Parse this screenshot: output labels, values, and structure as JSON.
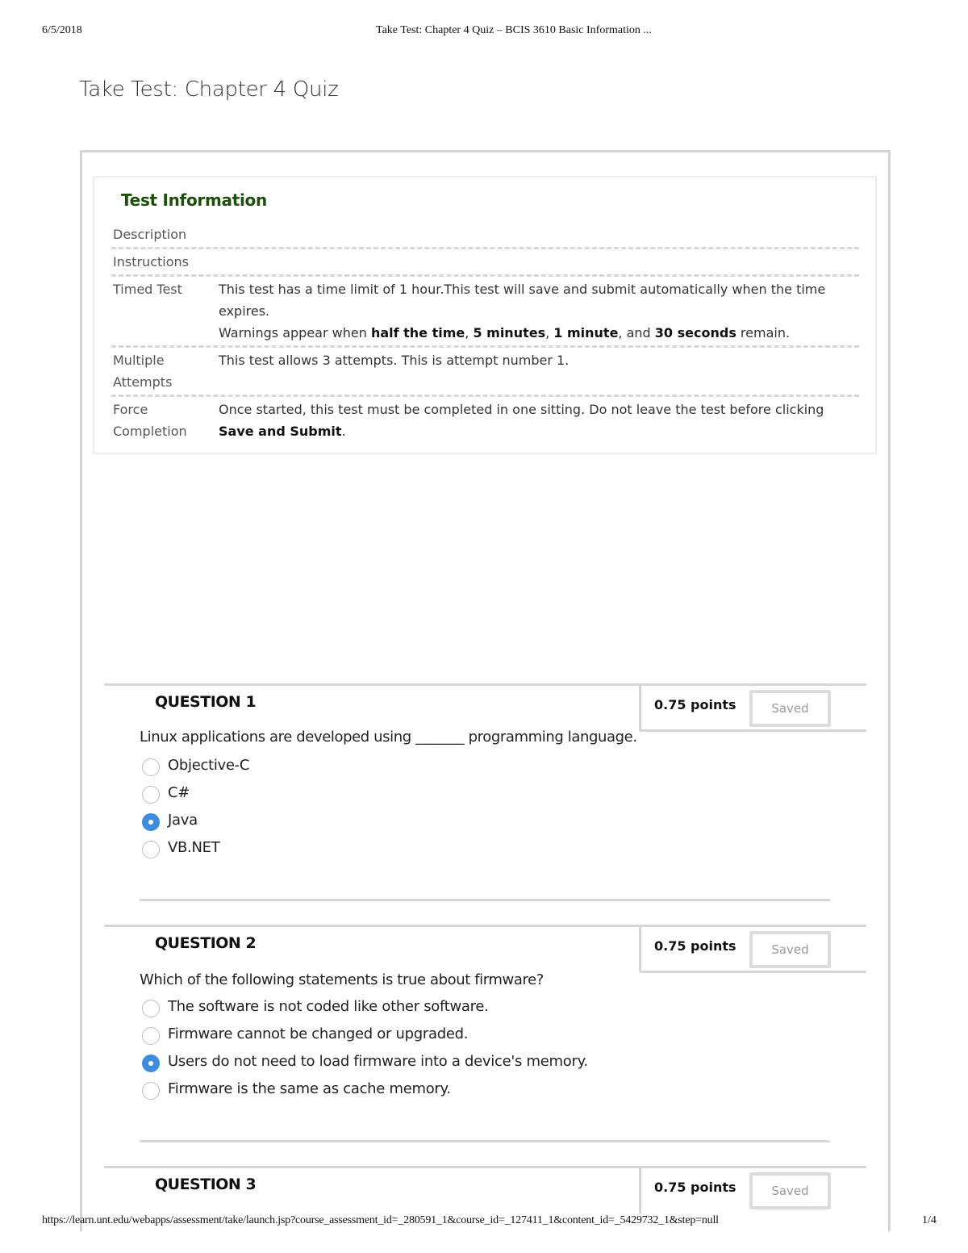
{
  "print_header": {
    "date": "6/5/2018",
    "title": "Take Test: Chapter 4 Quiz – BCIS 3610 Basic Information ..."
  },
  "print_footer": {
    "url": "https://learn.unt.edu/webapps/assessment/take/launch.jsp?course_assessment_id=_280591_1&course_id=_127411_1&content_id=_5429732_1&step=null",
    "page": "1/4"
  },
  "page_title": "Take Test: Chapter 4 Quiz",
  "test_info": {
    "heading": "Test Information",
    "rows": {
      "description": {
        "label": "Description",
        "value": ""
      },
      "instructions": {
        "label": "Instructions",
        "value": ""
      },
      "timed_test": {
        "label": "Timed Test",
        "line1": "This test has a time limit of 1 hour.This test will save and submit automatically when the time expires.",
        "warn_prefix": "Warnings appear when ",
        "warn_b1": "half the time",
        "warn_sep1": ", ",
        "warn_b2": "5 minutes",
        "warn_sep2": ", ",
        "warn_b3": "1 minute",
        "warn_sep3": ", and ",
        "warn_b4": "30 seconds",
        "warn_suffix": " remain."
      },
      "multiple_attempts": {
        "label": "Multiple Attempts",
        "value": "This test allows 3 attempts. This is attempt number 1."
      },
      "force_completion": {
        "label": "Force Completion",
        "value_prefix": "Once started, this test must be completed in one sitting. Do not leave the test before clicking ",
        "value_bold": "Save and Submit",
        "value_suffix": "."
      }
    }
  },
  "questions": [
    {
      "title": "QUESTION 1",
      "points": "0.75 points",
      "saved_label": "Saved",
      "text": "Linux applications are developed using _______ programming language.",
      "options": [
        {
          "label": "Objective-C",
          "selected": false
        },
        {
          "label": "C#",
          "selected": false
        },
        {
          "label": "Java",
          "selected": true
        },
        {
          "label": "VB.NET",
          "selected": false
        }
      ]
    },
    {
      "title": "QUESTION 2",
      "points": "0.75 points",
      "saved_label": "Saved",
      "text": "Which of the following statements is true about firmware?",
      "options": [
        {
          "label": "The software is not coded like other software.",
          "selected": false
        },
        {
          "label": "Firmware cannot be changed or upgraded.",
          "selected": false
        },
        {
          "label": "Users do not need to load firmware into a device's memory.",
          "selected": true
        },
        {
          "label": "Firmware is the same as cache memory.",
          "selected": false
        }
      ]
    },
    {
      "title": "QUESTION 3",
      "points": "0.75 points",
      "saved_label": "Saved"
    }
  ],
  "colors": {
    "heading_green": "#1f4d0e",
    "radio_selected": "#3c8dde"
  }
}
